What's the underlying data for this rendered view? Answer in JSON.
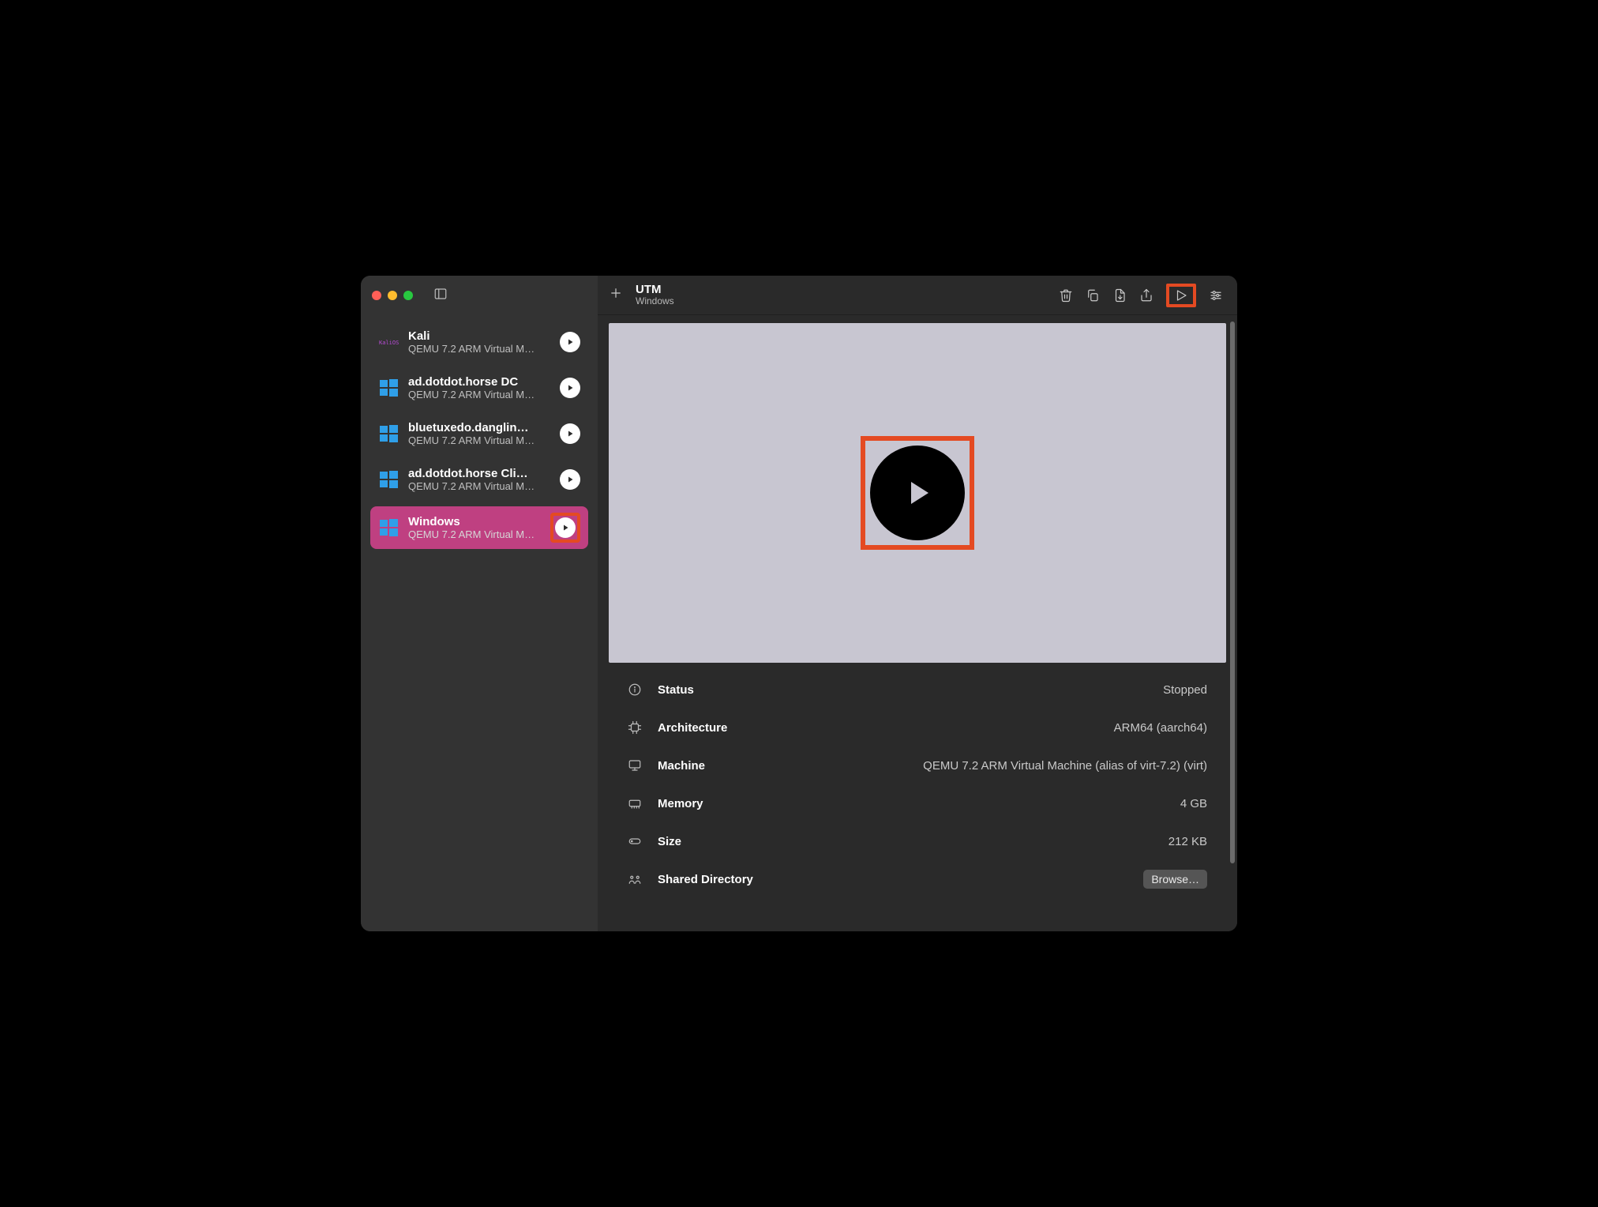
{
  "header": {
    "app_title": "UTM",
    "subtitle": "Windows"
  },
  "sidebar": {
    "items": [
      {
        "name": "Kali",
        "sub": "QEMU 7.2 ARM Virtual M…",
        "os": "kali",
        "selected": false
      },
      {
        "name": "ad.dotdot.horse DC",
        "sub": "QEMU 7.2 ARM Virtual M…",
        "os": "windows",
        "selected": false
      },
      {
        "name": "bluetuxedo.danglin…",
        "sub": "QEMU 7.2 ARM Virtual M…",
        "os": "windows",
        "selected": false
      },
      {
        "name": "ad.dotdot.horse Cli…",
        "sub": "QEMU 7.2 ARM Virtual M…",
        "os": "windows",
        "selected": false
      },
      {
        "name": "Windows",
        "sub": "QEMU 7.2 ARM Virtual M…",
        "os": "windows",
        "selected": true
      }
    ]
  },
  "details": {
    "status_label": "Status",
    "status_value": "Stopped",
    "arch_label": "Architecture",
    "arch_value": "ARM64 (aarch64)",
    "machine_label": "Machine",
    "machine_value": "QEMU 7.2 ARM Virtual Machine (alias of virt-7.2) (virt)",
    "memory_label": "Memory",
    "memory_value": "4 GB",
    "size_label": "Size",
    "size_value": "212 KB",
    "shared_label": "Shared Directory",
    "browse_label": "Browse…"
  },
  "highlight_color": "#e44a22",
  "selection_color": "#bf4081"
}
